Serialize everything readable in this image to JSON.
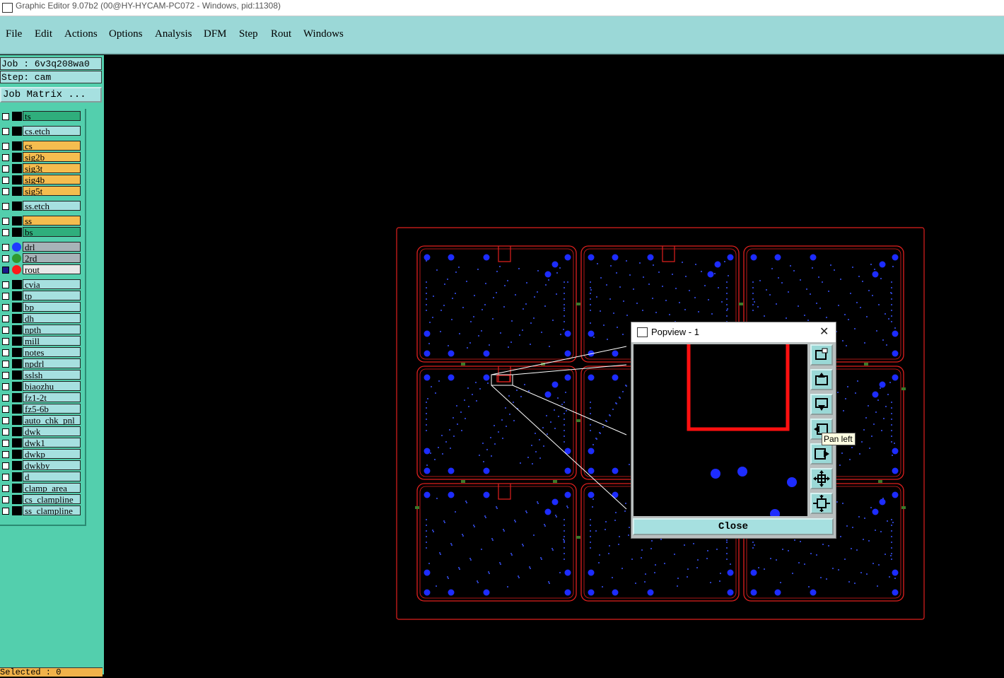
{
  "window": {
    "title": "Graphic Editor 9.07b2 (00@HY-HYCAM-PC072 - Windows, pid:11308)"
  },
  "menu": {
    "file": "File",
    "edit": "Edit",
    "actions": "Actions",
    "options": "Options",
    "analysis": "Analysis",
    "dfm": "DFM",
    "step": "Step",
    "rout": "Rout",
    "windows": "Windows"
  },
  "job": {
    "job_label": "Job : 6v3q208wa0",
    "step_label": "Step: cam",
    "matrix_button": "Job Matrix ..."
  },
  "layers": [
    {
      "name": "ts",
      "color": "#2fae7c",
      "mark": "black",
      "checked": false
    },
    {
      "name": "cs.etch",
      "color": "#a6e0e0",
      "mark": "black",
      "checked": false
    },
    {
      "name": "cs",
      "color": "#f5bd4f",
      "mark": "black",
      "checked": false
    },
    {
      "name": "sig2b",
      "color": "#f5bd4f",
      "mark": "black",
      "checked": false
    },
    {
      "name": "sig3t",
      "color": "#f5bd4f",
      "mark": "black",
      "checked": false
    },
    {
      "name": "sig4b",
      "color": "#f5bd4f",
      "mark": "black",
      "checked": false
    },
    {
      "name": "sig5t",
      "color": "#f5bd4f",
      "mark": "black",
      "checked": false
    },
    {
      "name": "ss.etch",
      "color": "#a6e0e0",
      "mark": "black",
      "checked": false
    },
    {
      "name": "ss",
      "color": "#f5bd4f",
      "mark": "black",
      "checked": false
    },
    {
      "name": "bs",
      "color": "#2fae7c",
      "mark": "black",
      "checked": false
    },
    {
      "name": "drl",
      "color": "#a7b3b8",
      "mark": "#1f3bff",
      "checked": false
    },
    {
      "name": "2rd",
      "color": "#a7b3b8",
      "mark": "#2f9a2f",
      "checked": false
    },
    {
      "name": "rout",
      "color": "#e8e8e8",
      "mark": "#ff1a1a",
      "checked": true
    },
    {
      "name": "cvia",
      "color": "#a6e0e0",
      "mark": "black",
      "checked": false
    },
    {
      "name": "tp",
      "color": "#a6e0e0",
      "mark": "black",
      "checked": false
    },
    {
      "name": "bp",
      "color": "#a6e0e0",
      "mark": "black",
      "checked": false
    },
    {
      "name": "dh",
      "color": "#a6e0e0",
      "mark": "black",
      "checked": false
    },
    {
      "name": "npth",
      "color": "#a6e0e0",
      "mark": "black",
      "checked": false
    },
    {
      "name": "mill",
      "color": "#a6e0e0",
      "mark": "black",
      "checked": false
    },
    {
      "name": "notes",
      "color": "#a6e0e0",
      "mark": "black",
      "checked": false
    },
    {
      "name": "npdrl",
      "color": "#a6e0e0",
      "mark": "black",
      "checked": false
    },
    {
      "name": "sslsh",
      "color": "#a6e0e0",
      "mark": "black",
      "checked": false
    },
    {
      "name": "biaozhu",
      "color": "#a6e0e0",
      "mark": "black",
      "checked": false
    },
    {
      "name": "fz1-2t",
      "color": "#a6e0e0",
      "mark": "black",
      "checked": false
    },
    {
      "name": "fz5-6b",
      "color": "#a6e0e0",
      "mark": "black",
      "checked": false
    },
    {
      "name": "auto_chk_pnl",
      "color": "#a6e0e0",
      "mark": "black",
      "checked": false
    },
    {
      "name": "dwk",
      "color": "#a6e0e0",
      "mark": "black",
      "checked": false
    },
    {
      "name": "dwk1",
      "color": "#a6e0e0",
      "mark": "black",
      "checked": false
    },
    {
      "name": "dwkp",
      "color": "#a6e0e0",
      "mark": "black",
      "checked": false
    },
    {
      "name": "dwkby",
      "color": "#a6e0e0",
      "mark": "black",
      "checked": false
    },
    {
      "name": "d",
      "color": "#a6e0e0",
      "mark": "black",
      "checked": false
    },
    {
      "name": "clamp_area",
      "color": "#a6e0e0",
      "mark": "black",
      "checked": false
    },
    {
      "name": "cs_clampline",
      "color": "#a6e0e0",
      "mark": "black",
      "checked": false
    },
    {
      "name": "ss_clampline",
      "color": "#a6e0e0",
      "mark": "black",
      "checked": false
    }
  ],
  "status": {
    "selected": "Selected : 0"
  },
  "popview": {
    "title": "Popview - 1",
    "close_label": "Close",
    "buttons": [
      "zoom-fit-icon",
      "pan-up-icon",
      "pan-down-icon",
      "pan-left-icon",
      "pan-right-icon",
      "zoom-out-icon",
      "zoom-in-icon"
    ]
  },
  "tooltip": {
    "text": "Pan left"
  },
  "colors": {
    "outline": "#e0201e",
    "pad": "#1d2cff",
    "trace": "#2b3fbf",
    "menubar": "#9bd8d7",
    "panel": "#53cfad"
  }
}
